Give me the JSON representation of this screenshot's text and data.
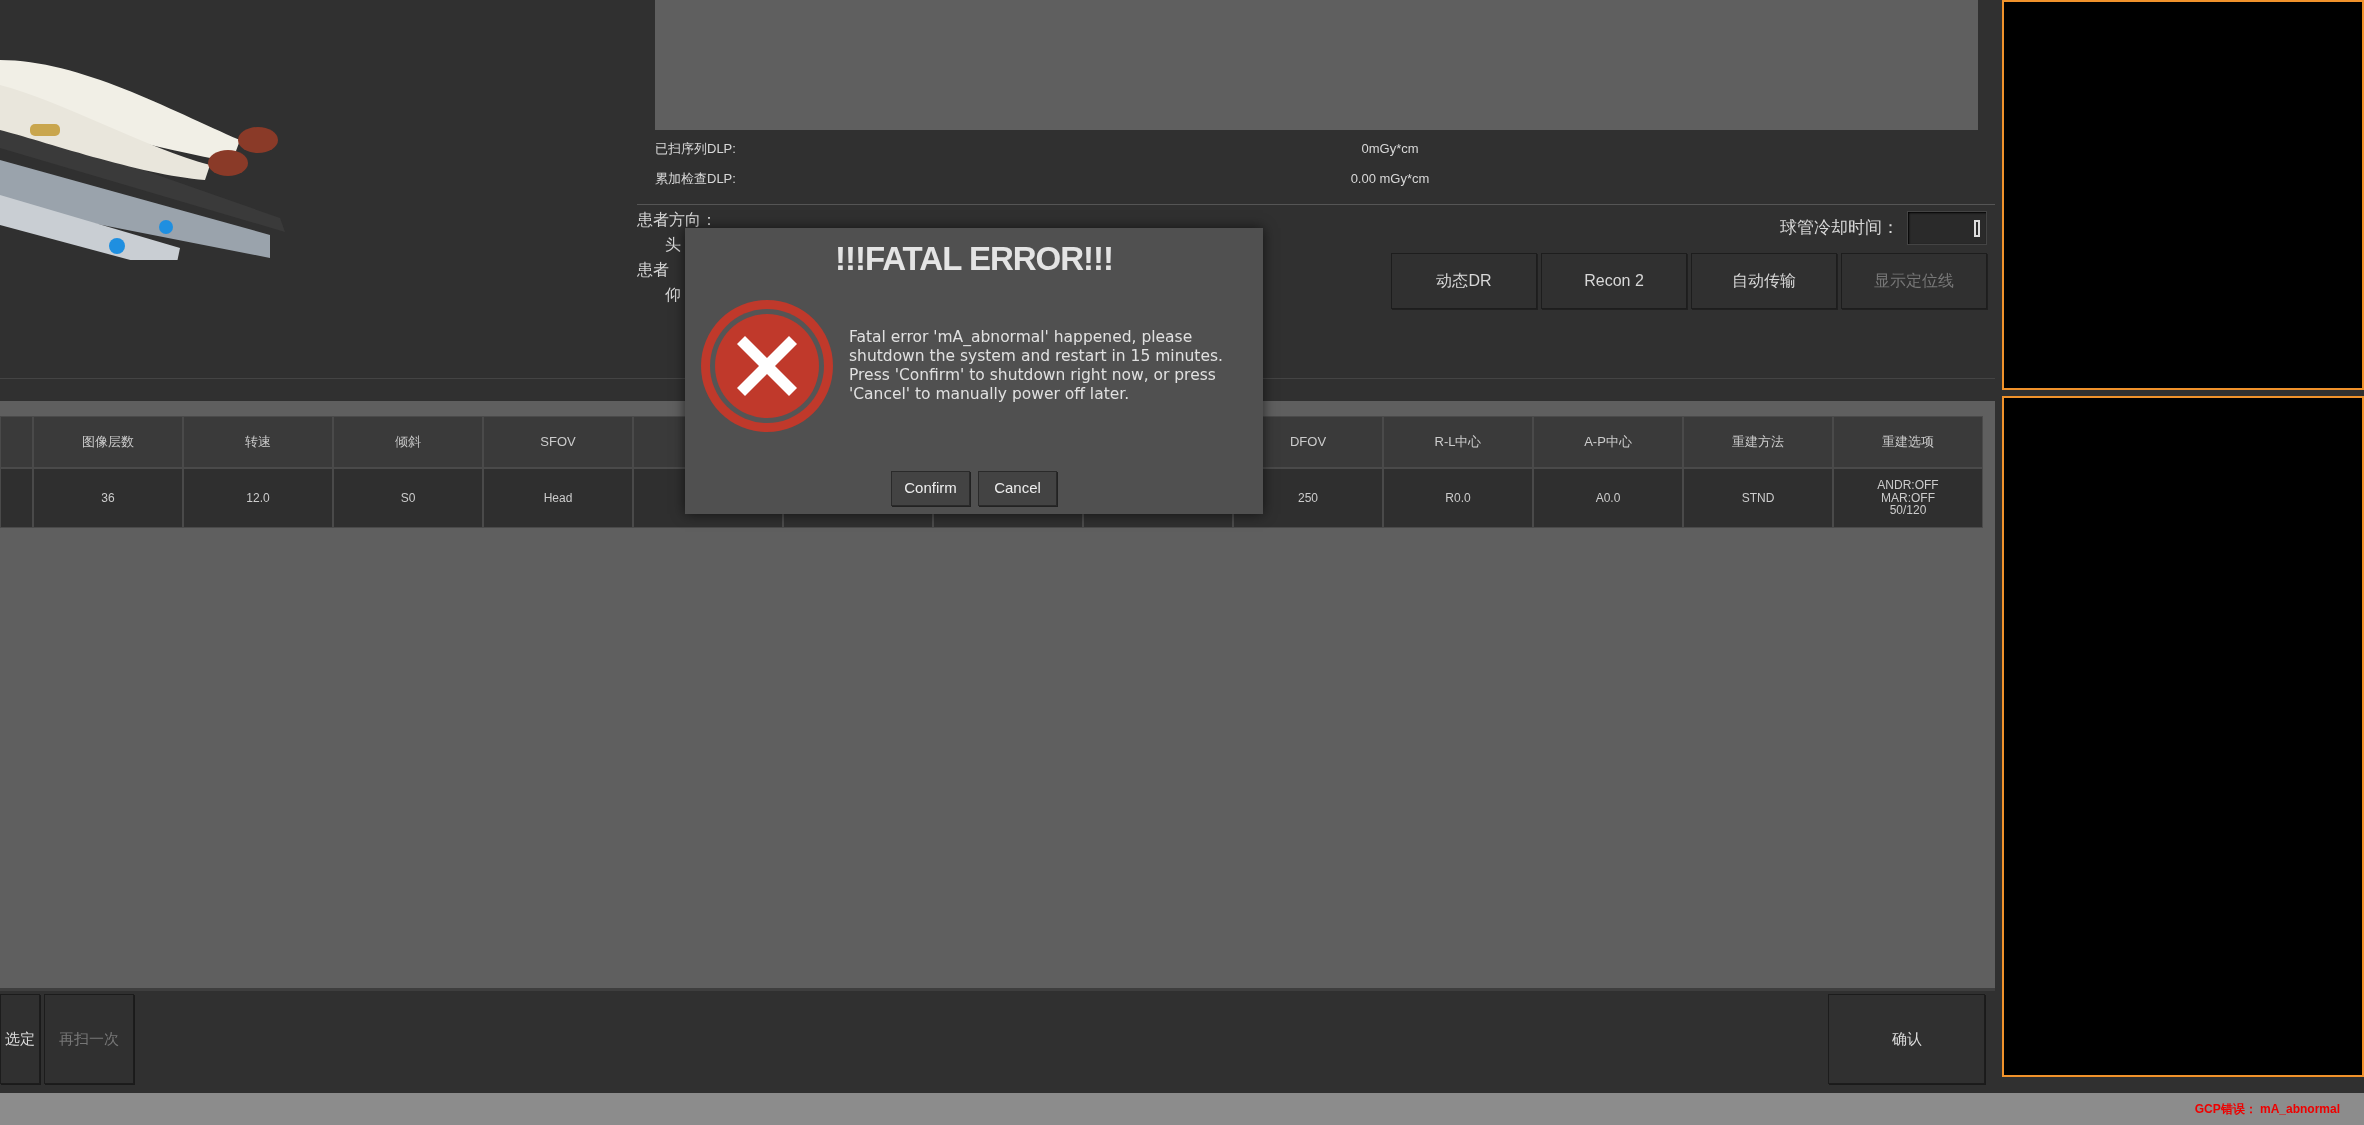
{
  "dose": [
    {
      "label": "已扫序列DLP:",
      "value": "0mGy*cm"
    },
    {
      "label": "累加检查DLP:",
      "value": "0.00 mGy*cm"
    }
  ],
  "patient": {
    "direction_label": "患者方向：",
    "direction_value": "头",
    "position_label": "患者",
    "position_value": "仰"
  },
  "tube_cooling": {
    "label": "球管冷却时间："
  },
  "actions": [
    {
      "label": "动态DR",
      "disabled": false
    },
    {
      "label": "Recon 2",
      "disabled": false
    },
    {
      "label": "自动传输",
      "disabled": false
    },
    {
      "label": "显示定位线",
      "disabled": true
    }
  ],
  "table": {
    "columns": [
      {
        "kind": "cut"
      },
      {
        "kind": "normal",
        "header": "图像层数",
        "cell": [
          "36"
        ]
      },
      {
        "kind": "normal",
        "header": "转速",
        "cell": [
          "12.0"
        ]
      },
      {
        "kind": "normal",
        "header": "倾斜",
        "cell": [
          "S0"
        ]
      },
      {
        "kind": "normal",
        "header": "SFOV",
        "cell": [
          "Head"
        ]
      },
      {
        "kind": "covered"
      },
      {
        "kind": "covered"
      },
      {
        "kind": "covered"
      },
      {
        "kind": "covered"
      },
      {
        "kind": "normal",
        "header": "DFOV",
        "cell": [
          "250"
        ]
      },
      {
        "kind": "normal",
        "header": "R-L中心",
        "cell": [
          "R0.0"
        ]
      },
      {
        "kind": "normal",
        "header": "A-P中心",
        "cell": [
          "A0.0"
        ]
      },
      {
        "kind": "normal",
        "header": "重建方法",
        "cell": [
          "STND"
        ]
      },
      {
        "kind": "normal",
        "header": "重建选项",
        "cell": [
          "ANDR:OFF",
          "MAR:OFF",
          "50/120"
        ]
      }
    ]
  },
  "bottom_buttons": [
    {
      "label": "选定",
      "disabled": false
    },
    {
      "label": "再扫一次",
      "disabled": true
    }
  ],
  "confirm_button": {
    "label": "确认"
  },
  "status_bar": {
    "error": "GCP错误： mA_abnormal"
  },
  "dialog": {
    "title": "!!!FATAL ERROR!!!",
    "message": "Fatal error 'mA_abnormal' happened, please shutdown the system and restart in 15 minutes. Press 'Confirm' to shutdown right now, or press 'Cancel' to manually power off later.",
    "buttons": [
      {
        "label": "Confirm"
      },
      {
        "label": "Cancel"
      }
    ]
  }
}
